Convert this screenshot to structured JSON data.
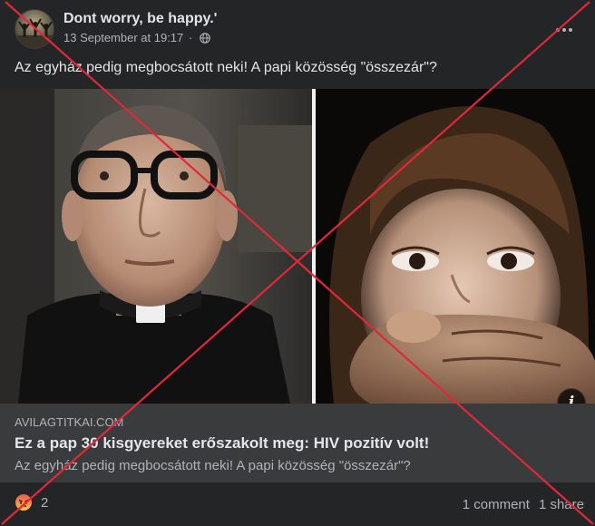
{
  "post": {
    "author": "Dont worry, be happy.'",
    "timestamp": "13 September at 19:17",
    "separator": "·",
    "privacy_icon": "globe-icon",
    "more_icon": "more-options-icon",
    "caption": "Az egyház pedig megbocsátott neki! A papi közösség \"összezár\"?"
  },
  "media": {
    "info_label": "i",
    "left_image": "priest-photo",
    "right_image": "child-covered-mouth-photo"
  },
  "link_preview": {
    "domain": "AVILAGTITKAI.COM",
    "title": "Ez a pap 30 kisgyereket erőszakolt meg: HIV pozitív volt!",
    "description": "Az egyház pedig megbocsátott neki! A papi közösség \"összezár\"?"
  },
  "footer": {
    "reaction_icon": "angry-reaction-icon",
    "reaction_count": "2",
    "comments": "1 comment",
    "shares": "1 share"
  },
  "colors": {
    "background": "#242526",
    "preview_background": "#3a3b3c",
    "text_primary": "#e4e6eb",
    "text_secondary": "#b0b3b8",
    "cross": "#e0283a"
  }
}
